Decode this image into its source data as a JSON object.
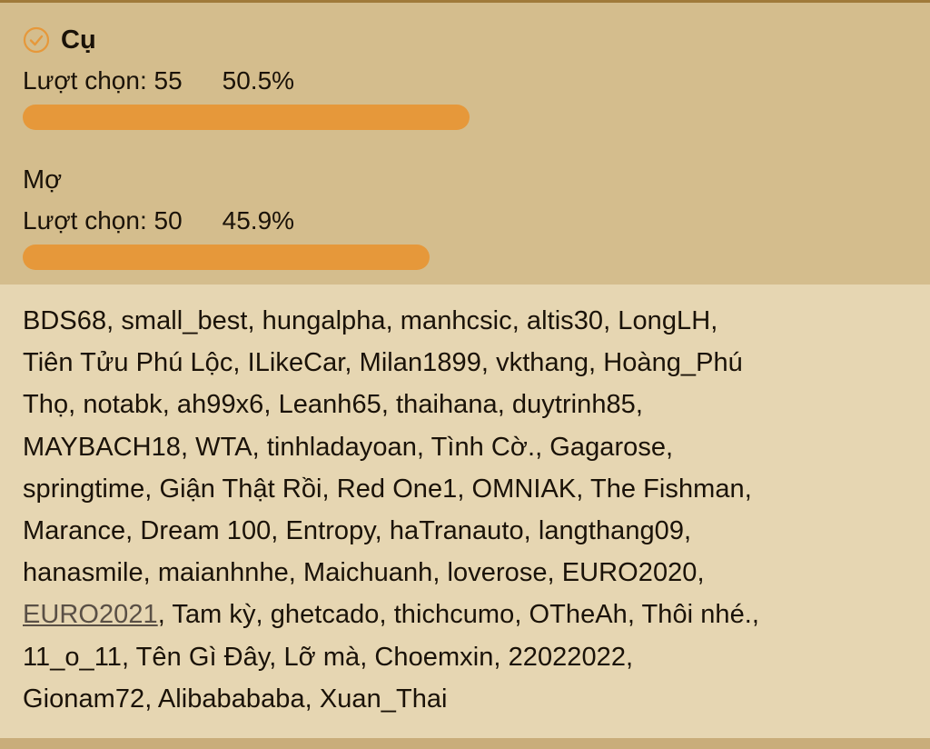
{
  "poll": {
    "options": [
      {
        "label": "Cụ",
        "votes_text": "Lượt chọn: 55",
        "percent_text": "50.5%",
        "percent": 50.5,
        "voted": true
      },
      {
        "label": "Mợ",
        "votes_text": "Lượt chọn: 50",
        "percent_text": "45.9%",
        "percent": 45.9,
        "voted": false
      }
    ],
    "bar_color": "#e6983a"
  },
  "voters": {
    "lines": [
      "BDS68, small_best, hungalpha, manhcsic, altis30, LongLH,",
      "Tiên Tửu Phú Lộc, ILikeCar, Milan1899, vkthang, Hoàng_Phú",
      "Thọ, notabk, ah99x6, Leanh65, thaihana, duytrinh85,",
      "MAYBACH18, WTA, tinhladayoan, Tình Cờ., Gagarose,",
      "springtime, Giận Thật Rồi, Red One1, OMNIAK, The Fishman,",
      "Marance, Dream 100, Entropy, haTranauto, langthang09,",
      "hanasmile, maianhnhe, Maichuanh, loverose, EURO2020,"
    ],
    "link_name": "EURO2021",
    "line8_rest": ", Tam kỳ, ghetcado, thichcumo, OTheAh, Thôi nhé.,",
    "lines_after": [
      "11_o_11, Tên Gì Đây, Lỡ mà, Choemxin, 22022022,",
      "Gionam72, Alibabababa, Xuan_Thai"
    ]
  },
  "icons": {
    "voted_icon": "check-circle-icon"
  }
}
